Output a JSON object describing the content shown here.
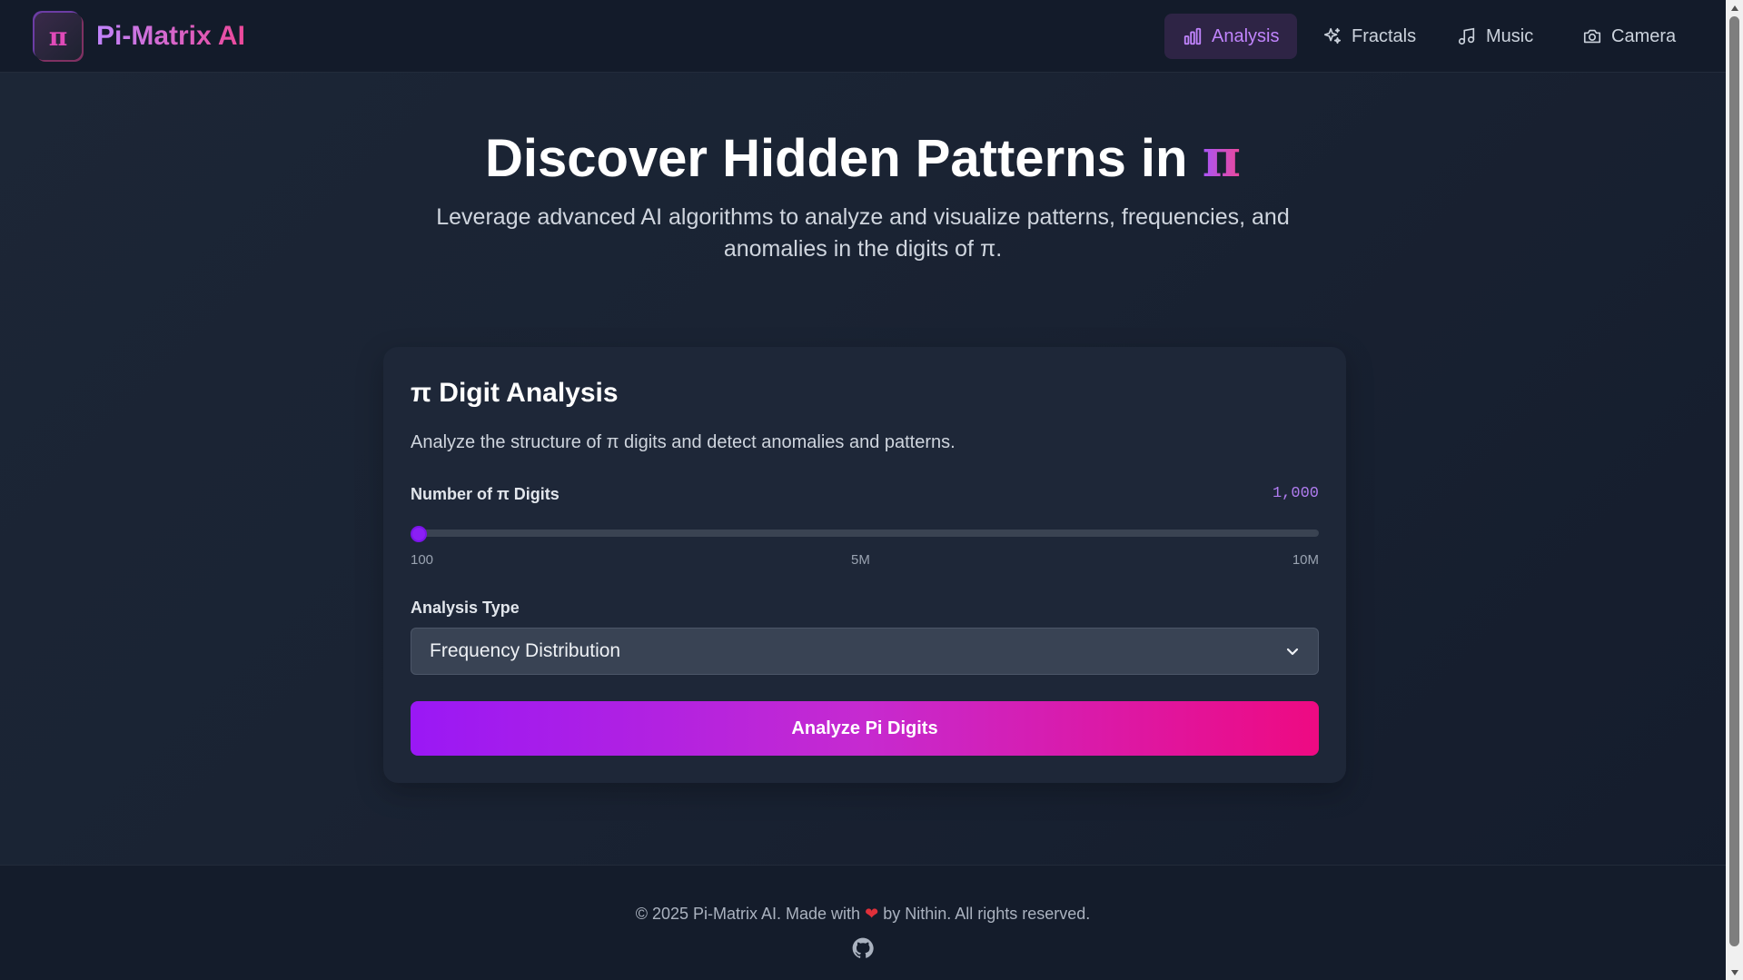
{
  "navbar": {
    "logo_glyph": "π",
    "brand": "Pi-Matrix AI",
    "items": [
      {
        "label": "Analysis",
        "icon": "bar-chart-icon",
        "active": true
      },
      {
        "label": "Fractals",
        "icon": "sparkles-icon",
        "active": false
      },
      {
        "label": "Music",
        "icon": "music-note-icon",
        "active": false
      },
      {
        "label": "Camera",
        "icon": "camera-icon",
        "active": false
      }
    ]
  },
  "hero": {
    "title": "Discover Hidden Patterns in",
    "title_pi": "π",
    "subtitle": "Leverage advanced AI algorithms to analyze and visualize patterns, frequencies, and anomalies in the digits of π."
  },
  "card": {
    "title": "π Digit Analysis",
    "description": "Analyze the structure of π digits and detect anomalies and patterns.",
    "digits_label": "Number of π Digits",
    "digits_value": "1,000",
    "slider": {
      "min_label": "100",
      "mid_label": "5M",
      "max_label": "10M",
      "value_fraction": 0.0001
    },
    "analysis_type_label": "Analysis Type",
    "analysis_type_selected": "Frequency Distribution",
    "analyze_button": "Analyze Pi Digits"
  },
  "footer": {
    "text_before": "© 2025 Pi-Matrix AI. Made with",
    "heart": "❤",
    "text_after": "by Nithin. All rights reserved.",
    "github_icon": "github-icon"
  },
  "colors": {
    "accent_purple": "#a855f7",
    "accent_pink": "#ec4899",
    "background": "#1a2333",
    "card": "#1e2738"
  }
}
